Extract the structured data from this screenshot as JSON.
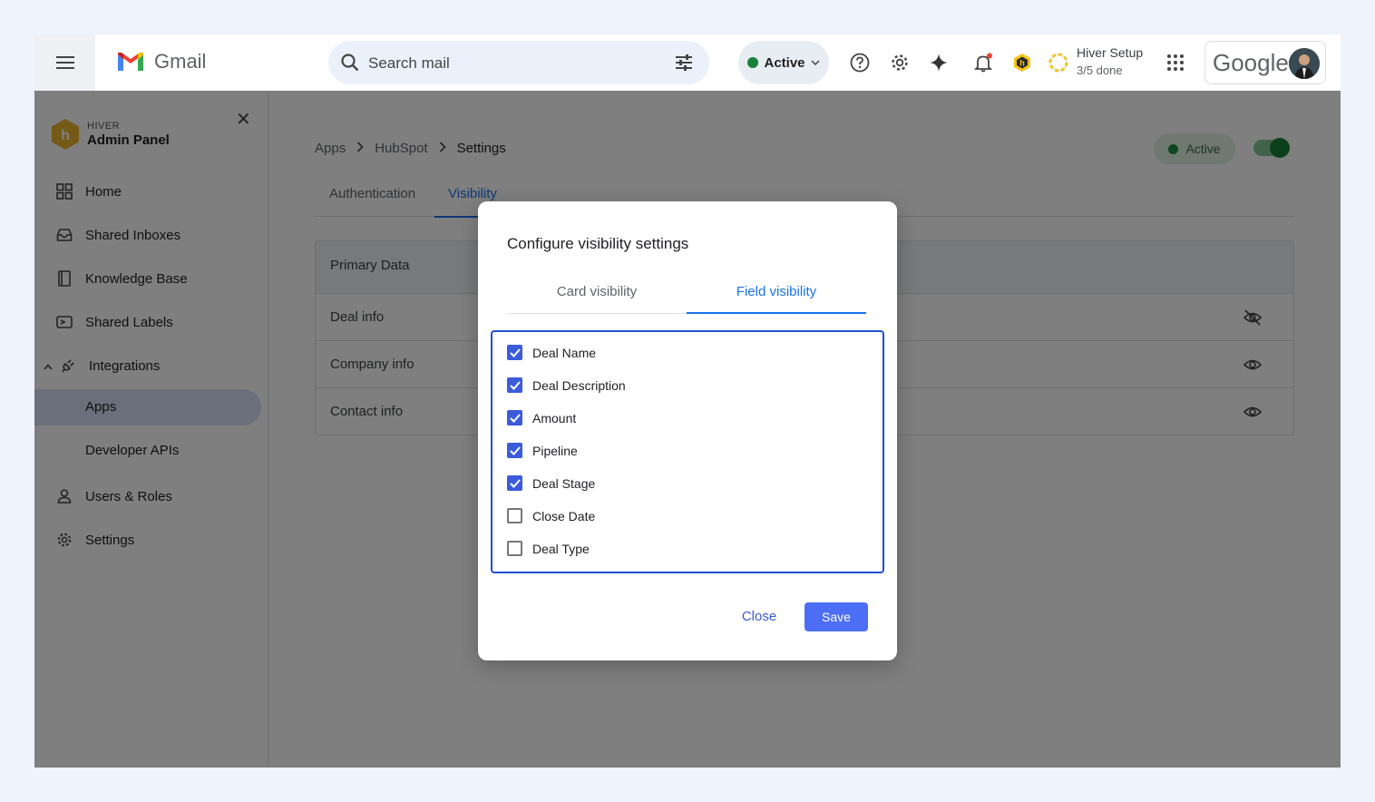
{
  "gmail": {
    "logo_text": "Gmail",
    "search_placeholder": "Search mail",
    "status": "Active",
    "hiver_setup_title": "Hiver Setup",
    "hiver_setup_progress": "3/5 done",
    "google_logo_text": "Google",
    "colors": {
      "status_green": "#188038",
      "notif_dot": "#ea4335"
    }
  },
  "sidebar": {
    "brand_small": "HIVER",
    "brand_title": "Admin Panel",
    "items": [
      {
        "label": "Home",
        "icon": "grid-icon"
      },
      {
        "label": "Shared Inboxes",
        "icon": "inbox-icon"
      },
      {
        "label": "Knowledge Base",
        "icon": "book-icon"
      },
      {
        "label": "Shared Labels",
        "icon": "label-icon"
      },
      {
        "label": "Integrations",
        "icon": "plug-icon",
        "expanded": true
      }
    ],
    "sub_items": [
      {
        "label": "Apps",
        "selected": true
      },
      {
        "label": "Developer APIs",
        "selected": false
      }
    ],
    "bottom_items": [
      {
        "label": "Users & Roles",
        "icon": "user-icon"
      },
      {
        "label": "Settings",
        "icon": "gear-icon"
      }
    ]
  },
  "main": {
    "breadcrumb": [
      "Apps",
      "HubSpot",
      "Settings"
    ],
    "active_chip": "Active",
    "toggle_on": true,
    "tabs": [
      {
        "label": "Authentication",
        "active": false
      },
      {
        "label": "Visibility",
        "active": true
      }
    ],
    "table_header": "Primary Data",
    "rows": [
      {
        "label": "Deal info",
        "visible": false
      },
      {
        "label": "Company info",
        "visible": true
      },
      {
        "label": "Contact info",
        "visible": true
      }
    ]
  },
  "dialog": {
    "title": "Configure visibility settings",
    "tabs": [
      {
        "label": "Card visibility",
        "active": false
      },
      {
        "label": "Field visibility",
        "active": true
      }
    ],
    "fields": [
      {
        "label": "Deal Name",
        "checked": true
      },
      {
        "label": "Deal Description",
        "checked": true
      },
      {
        "label": "Amount",
        "checked": true
      },
      {
        "label": "Pipeline",
        "checked": true
      },
      {
        "label": "Deal Stage",
        "checked": true
      },
      {
        "label": "Close Date",
        "checked": false
      },
      {
        "label": "Deal Type",
        "checked": false
      }
    ],
    "close_label": "Close",
    "save_label": "Save",
    "colors": {
      "accent": "#4c6ef5",
      "tab_blue": "#1a73e8"
    }
  }
}
